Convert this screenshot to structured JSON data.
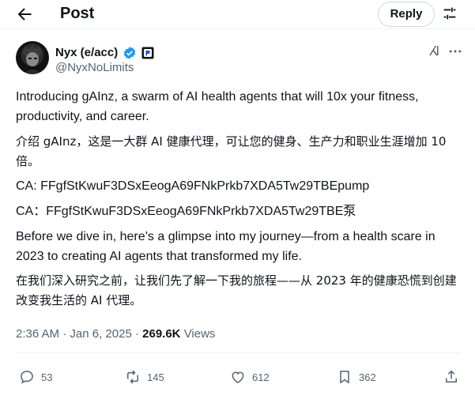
{
  "header": {
    "title": "Post",
    "reply_label": "Reply"
  },
  "author": {
    "name": "Nyx (e/acc)",
    "handle": "@NyxNoLimits"
  },
  "post": {
    "p1": "Introducing gAInz, a swarm of AI health agents that will 10x your fitness, productivity, and career.",
    "p2": "介绍 gAInz，这是一大群 AI 健康代理，可让您的健身、生产力和职业生涯增加 10 倍。",
    "p3": "CA: FFgfStKwuF3DSxEeogA69FNkPrkb7XDA5Tw29TBEpump",
    "p4": "CA：FFgfStKwuF3DSxEeogA69FNkPrkb7XDA5Tw29TBE泵",
    "p5": "Before we dive in, here’s a glimpse into my journey—from a health scare in 2023 to creating AI agents that transformed my life.",
    "p6": "在我们深入研究之前，让我们先了解一下我的旅程——从 2023 年的健康恐慌到创建改变我生活的 AI 代理。"
  },
  "meta": {
    "time": "2:36 AM",
    "separator": "·",
    "date": "Jan 6, 2025",
    "views_count": "269.6K",
    "views_label": "Views"
  },
  "actions": {
    "replies": "53",
    "reposts": "145",
    "likes": "612",
    "bookmarks": "362"
  },
  "colors": {
    "text": "#0f1419",
    "secondary": "#536471",
    "verified": "#1d9bf0",
    "border": "#cfd9de"
  }
}
